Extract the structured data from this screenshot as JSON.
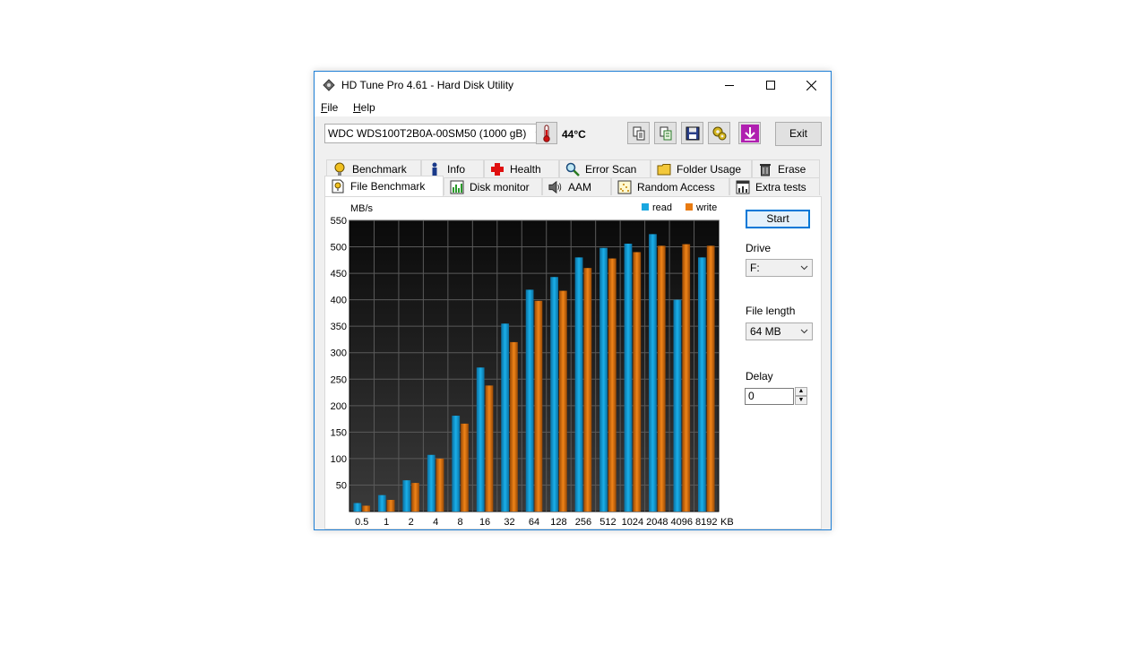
{
  "window": {
    "title": "HD Tune Pro 4.61 - Hard Disk Utility"
  },
  "menu": {
    "file_access": "F",
    "file_rest": "ile",
    "help_access": "H",
    "help_rest": "elp"
  },
  "toolbar": {
    "drive": "WDC WDS100T2B0A-00SM50 (1000 gB)",
    "temperature": "44°C",
    "exit_label": "Exit"
  },
  "tabs_row1": [
    {
      "label": "Benchmark",
      "icon": "benchmark-icon"
    },
    {
      "label": "Info",
      "icon": "info-icon"
    },
    {
      "label": "Health",
      "icon": "health-cross-icon"
    },
    {
      "label": "Error Scan",
      "icon": "magnifier-icon"
    },
    {
      "label": "Folder Usage",
      "icon": "folder-icon"
    },
    {
      "label": "Erase",
      "icon": "trash-icon"
    }
  ],
  "tabs_row2": [
    {
      "label": "File Benchmark",
      "icon": "file-benchmark-icon"
    },
    {
      "label": "Disk monitor",
      "icon": "disk-monitor-icon"
    },
    {
      "label": "AAM",
      "icon": "speaker-icon"
    },
    {
      "label": "Random Access",
      "icon": "random-access-icon"
    },
    {
      "label": "Extra tests",
      "icon": "extra-tests-icon"
    }
  ],
  "side": {
    "start_label": "Start",
    "drive_label": "Drive",
    "drive_value": "F:",
    "file_length_label": "File length",
    "file_length_value": "64 MB",
    "delay_label": "Delay",
    "delay_value": "0"
  },
  "colors": {
    "read": "#1aa7e0",
    "write": "#e87a10",
    "plot_bg": "#1a1a1a",
    "grid": "#5a5a5a"
  },
  "chart_data": {
    "type": "bar",
    "ylabel": "MB/s",
    "xunit": "KB",
    "ylim": [
      0,
      550
    ],
    "yticks": [
      50,
      100,
      150,
      200,
      250,
      300,
      350,
      400,
      450,
      500,
      550
    ],
    "categories": [
      "0.5",
      "1",
      "2",
      "4",
      "8",
      "16",
      "32",
      "64",
      "128",
      "256",
      "512",
      "1024",
      "2048",
      "4096",
      "8192"
    ],
    "legend_position": "top-right",
    "grid": true,
    "series": [
      {
        "name": "read",
        "values": [
          16,
          31,
          59,
          107,
          181,
          272,
          355,
          419,
          443,
          480,
          498,
          506,
          524,
          400,
          480
        ]
      },
      {
        "name": "write",
        "values": [
          11,
          22,
          54,
          100,
          166,
          238,
          320,
          398,
          417,
          460,
          478,
          490,
          502,
          505,
          502
        ]
      }
    ]
  }
}
